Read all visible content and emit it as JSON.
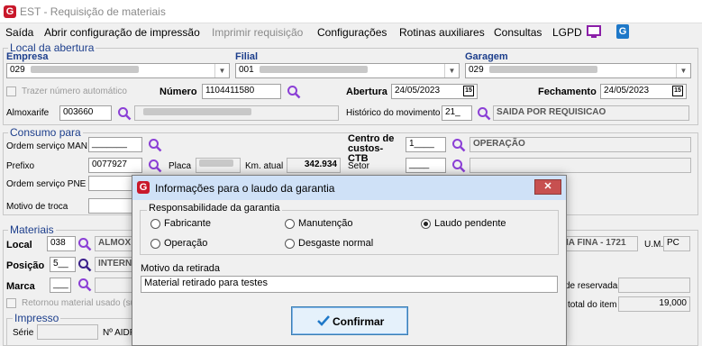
{
  "window": {
    "title": "EST - Requisição de materiais"
  },
  "menu": {
    "items": [
      "Saída",
      "Abrir configuração de impressão",
      "Imprimir requisição",
      "Configurações",
      "Rotinas auxiliares",
      "Consultas",
      "LGPD"
    ]
  },
  "local_abertura": {
    "group_label": "Local da abertura",
    "empresa_label": "Empresa",
    "empresa_value": "029",
    "filial_label": "Filial",
    "filial_value": "001",
    "garagem_label": "Garagem",
    "garagem_value": "029",
    "trazer_numero_label": "Trazer número automático",
    "numero_label": "Número",
    "numero_value": "1104411580",
    "abertura_label": "Abertura",
    "abertura_value": "24/05/2023",
    "fechamento_label": "Fechamento",
    "fechamento_value": "24/05/2023",
    "almoxarife_label": "Almoxarife",
    "almoxarife_value": "003660",
    "historico_label": "Histórico do movimento",
    "historico_code": "21_",
    "historico_desc": "SAIDA POR REQUISICAO"
  },
  "consumo": {
    "group_label": "Consumo para",
    "os_man_label": "Ordem serviço MAN",
    "os_man_value": "_______",
    "prefixo_label": "Prefixo",
    "prefixo_value": "0077927",
    "placa_label": "Placa",
    "km_label": "Km. atual",
    "km_value": "342.934",
    "os_pne_label": "Ordem serviço PNE",
    "motivo_troca_label": "Motivo de troca",
    "centro_label": "Centro de custos-CTB",
    "centro_code": "1____",
    "centro_desc": "OPERAÇÃO",
    "setor_label": "Setor",
    "setor_value": "____"
  },
  "materiais": {
    "group_label": "Materiais",
    "local_label": "Local",
    "local_code": "038",
    "local_desc_start": "ALMOX",
    "local_desc_end": "IA FINA - 1721",
    "um_label": "U.M.",
    "um_value": "PC",
    "posicao_label": "Posição",
    "posicao_code": "5__",
    "posicao_desc": "INTERN",
    "marca_label": "Marca",
    "marca_code": "___",
    "retornou_label": "Retornou material usado (suc",
    "reservada_label": "de reservada",
    "total_label": "total do item",
    "total_value": "19,000",
    "impresso_label": "Impresso",
    "serie_label": "Série",
    "aidf_label": "Nº AIDF"
  },
  "dialog": {
    "title": "Informações para o laudo da garantia",
    "close_label": "✕",
    "responsabilidade_label": "Responsabilidade da garantia",
    "options": [
      {
        "label": "Fabricante",
        "checked": false
      },
      {
        "label": "Manutenção",
        "checked": false
      },
      {
        "label": "Laudo pendente",
        "checked": true
      },
      {
        "label": "Operação",
        "checked": false
      },
      {
        "label": "Desgaste normal",
        "checked": false
      }
    ],
    "motivo_label": "Motivo da retirada",
    "motivo_value": "Material retirado para testes",
    "confirm_label": "Confirmar"
  },
  "colors": {
    "accent": "#1c3e8c",
    "search_icon": "#8b3fd6",
    "brand_red": "#c9182b"
  }
}
